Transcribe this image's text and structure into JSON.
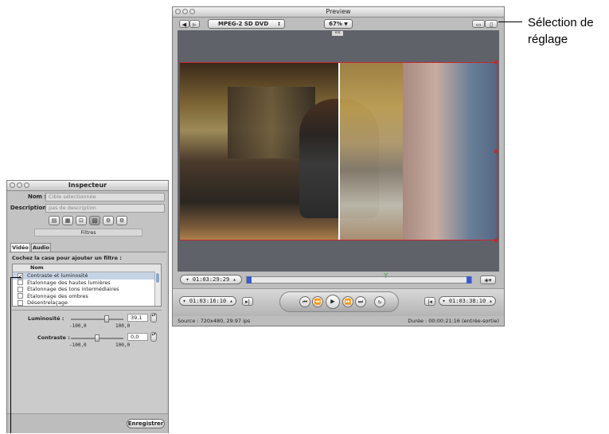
{
  "preview": {
    "title": "Preview",
    "preset": "MPEG-2 SD DVD",
    "zoom": "67%",
    "timecode_left": "01:03:29:29",
    "timecode_in": "01:03:16:10",
    "timecode_out": "01:03:38:10",
    "source_info": "Source : 720x480, 29.97 ips",
    "duration_info": "Durée : 00:00:21:16 (entrée-sortie)",
    "top_marker": "iris"
  },
  "callout": {
    "line1": "Sélection de",
    "line2": "réglage"
  },
  "inspector": {
    "title": "Inspecteur",
    "name_label": "Nom :",
    "name_value": "Cible sélectionnée",
    "desc_label": "Description :",
    "desc_value": "pas de description",
    "section_label": "Filtres",
    "tabs": [
      "Vidéo",
      "Audio"
    ],
    "instruction": "Cochez la case pour ajouter un filtre :",
    "column_header": "Nom",
    "filters": [
      {
        "label": "Contraste et luminosité",
        "checked": true
      },
      {
        "label": "Étalonnage des hautes lumières",
        "checked": false
      },
      {
        "label": "Étalonnage des tons intermédiaires",
        "checked": false
      },
      {
        "label": "Étalonnage des ombres",
        "checked": false
      },
      {
        "label": "Désentrelaçage",
        "checked": false
      }
    ],
    "brightness_label": "Luminosité :",
    "brightness_value": "39,1",
    "brightness_min": "-100,0",
    "brightness_max": "100,0",
    "brightness_level": 0.6955,
    "contrast_label": "Contraste :",
    "contrast_value": "0,0",
    "contrast_min": "-100,0",
    "contrast_max": "100,0",
    "contrast_level": 0.5,
    "save_label": "Enregistrer"
  }
}
